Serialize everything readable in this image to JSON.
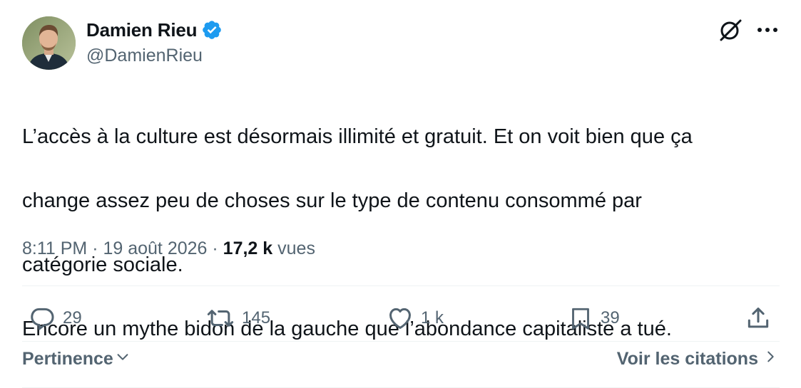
{
  "author": {
    "display_name": "Damien Rieu",
    "handle": "@DamienRieu",
    "verified": true,
    "verified_color": "#1d9bf0"
  },
  "tweet": {
    "text_lines": [
      "L’accès à la culture est désormais illimité et gratuit. Et on voit bien que ça",
      "change assez peu de choses sur le type de contenu consommé par",
      "catégorie sociale.",
      "Encore un mythe bidon de la gauche que l’abondance capitaliste a tué."
    ],
    "time": "8:11 PM",
    "separator": " · ",
    "date": "19 août 2026",
    "views_count": "17,2 k",
    "views_label": "vues"
  },
  "actions": {
    "replies": "29",
    "reposts": "145",
    "likes": "1 k",
    "bookmarks": "39"
  },
  "footer": {
    "sort_label": "Pertinence",
    "quotes_link": "Voir les citations"
  },
  "icons": {
    "grok": "grok-icon",
    "more": "more-icon",
    "reply": "reply-icon",
    "repost": "repost-icon",
    "like": "heart-icon",
    "bookmark": "bookmark-icon",
    "share": "share-icon"
  },
  "colors": {
    "text": "#0f1419",
    "secondary": "#536471",
    "divider": "#eff3f4"
  }
}
